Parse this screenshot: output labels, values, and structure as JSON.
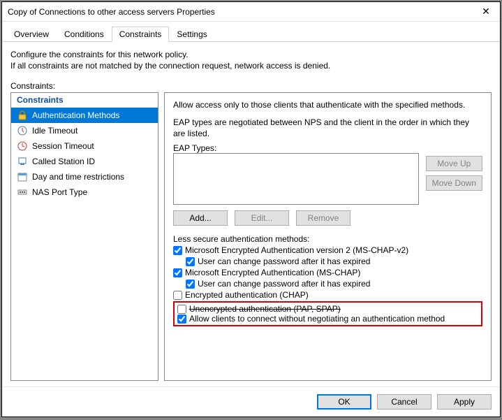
{
  "window": {
    "title": "Copy of Connections to other access servers Properties",
    "close": "✕"
  },
  "tabs": {
    "overview": "Overview",
    "conditions": "Conditions",
    "constraints": "Constraints",
    "settings": "Settings"
  },
  "intro": {
    "line1": "Configure the constraints for this network policy.",
    "line2": "If all constraints are not matched by the connection request, network access is denied."
  },
  "sidebar": {
    "label": "Constraints:",
    "heading": "Constraints",
    "items": [
      {
        "label": "Authentication Methods"
      },
      {
        "label": "Idle Timeout"
      },
      {
        "label": "Session Timeout"
      },
      {
        "label": "Called Station ID"
      },
      {
        "label": "Day and time restrictions"
      },
      {
        "label": "NAS Port Type"
      }
    ]
  },
  "panel": {
    "desc": "Allow access only to those clients that authenticate with the specified methods.",
    "eap_note": "EAP types are negotiated between NPS and the client in the order in which they are listed.",
    "eap_types_label": "EAP Types:",
    "move_up": "Move Up",
    "move_down": "Move Down",
    "add": "Add...",
    "edit": "Edit...",
    "remove": "Remove",
    "less_secure": "Less secure authentication methods:",
    "checks": {
      "mschap2": "Microsoft Encrypted Authentication version 2 (MS-CHAP-v2)",
      "mschap2_exp": "User can change password after it has expired",
      "mschap": "Microsoft Encrypted Authentication (MS-CHAP)",
      "mschap_exp": "User can change password after it has expired",
      "chap": "Encrypted authentication (CHAP)",
      "pap": "Unencrypted authentication (PAP, SPAP)",
      "allow_no_auth": "Allow clients to connect without negotiating an authentication method"
    }
  },
  "footer": {
    "ok": "OK",
    "cancel": "Cancel",
    "apply": "Apply"
  }
}
